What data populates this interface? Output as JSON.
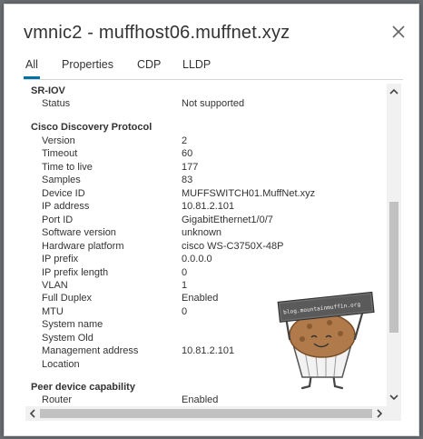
{
  "dialog": {
    "title": "vmnic2 - muffhost06.muffnet.xyz"
  },
  "tabs": [
    {
      "label": "All",
      "active": true
    },
    {
      "label": "Properties",
      "active": false
    },
    {
      "label": "CDP",
      "active": false
    },
    {
      "label": "LLDP",
      "active": false
    }
  ],
  "sections": {
    "sriov": {
      "title": "SR-IOV",
      "rows": [
        {
          "label": "Status",
          "value": "Not supported"
        }
      ]
    },
    "cdp": {
      "title": "Cisco Discovery Protocol",
      "rows": [
        {
          "label": "Version",
          "value": "2"
        },
        {
          "label": "Timeout",
          "value": "60"
        },
        {
          "label": "Time to live",
          "value": "177"
        },
        {
          "label": "Samples",
          "value": "83"
        },
        {
          "label": "Device ID",
          "value": "MUFFSWITCH01.MuffNet.xyz"
        },
        {
          "label": "IP address",
          "value": "10.81.2.101"
        },
        {
          "label": "Port ID",
          "value": "GigabitEthernet1/0/7"
        },
        {
          "label": "Software version",
          "value": "unknown"
        },
        {
          "label": "Hardware platform",
          "value": "cisco WS-C3750X-48P"
        },
        {
          "label": "IP prefix",
          "value": "0.0.0.0"
        },
        {
          "label": "IP prefix length",
          "value": "0"
        },
        {
          "label": "VLAN",
          "value": "1"
        },
        {
          "label": "Full Duplex",
          "value": "Enabled"
        },
        {
          "label": "MTU",
          "value": "0"
        },
        {
          "label": "System name",
          "value": ""
        },
        {
          "label": "System Old",
          "value": ""
        },
        {
          "label": "Management address",
          "value": "10.81.2.101"
        },
        {
          "label": "Location",
          "value": ""
        }
      ]
    },
    "peer": {
      "title": "Peer device capability",
      "rows": [
        {
          "label": "Router",
          "value": "Enabled"
        }
      ]
    }
  },
  "watermark": {
    "text": "blog.mountainmuffin.org"
  },
  "colors": {
    "accent": "#0072a3",
    "text": "#333333",
    "scrollbar_track": "#f1f1f1",
    "scrollbar_thumb": "#c1c1c1"
  }
}
